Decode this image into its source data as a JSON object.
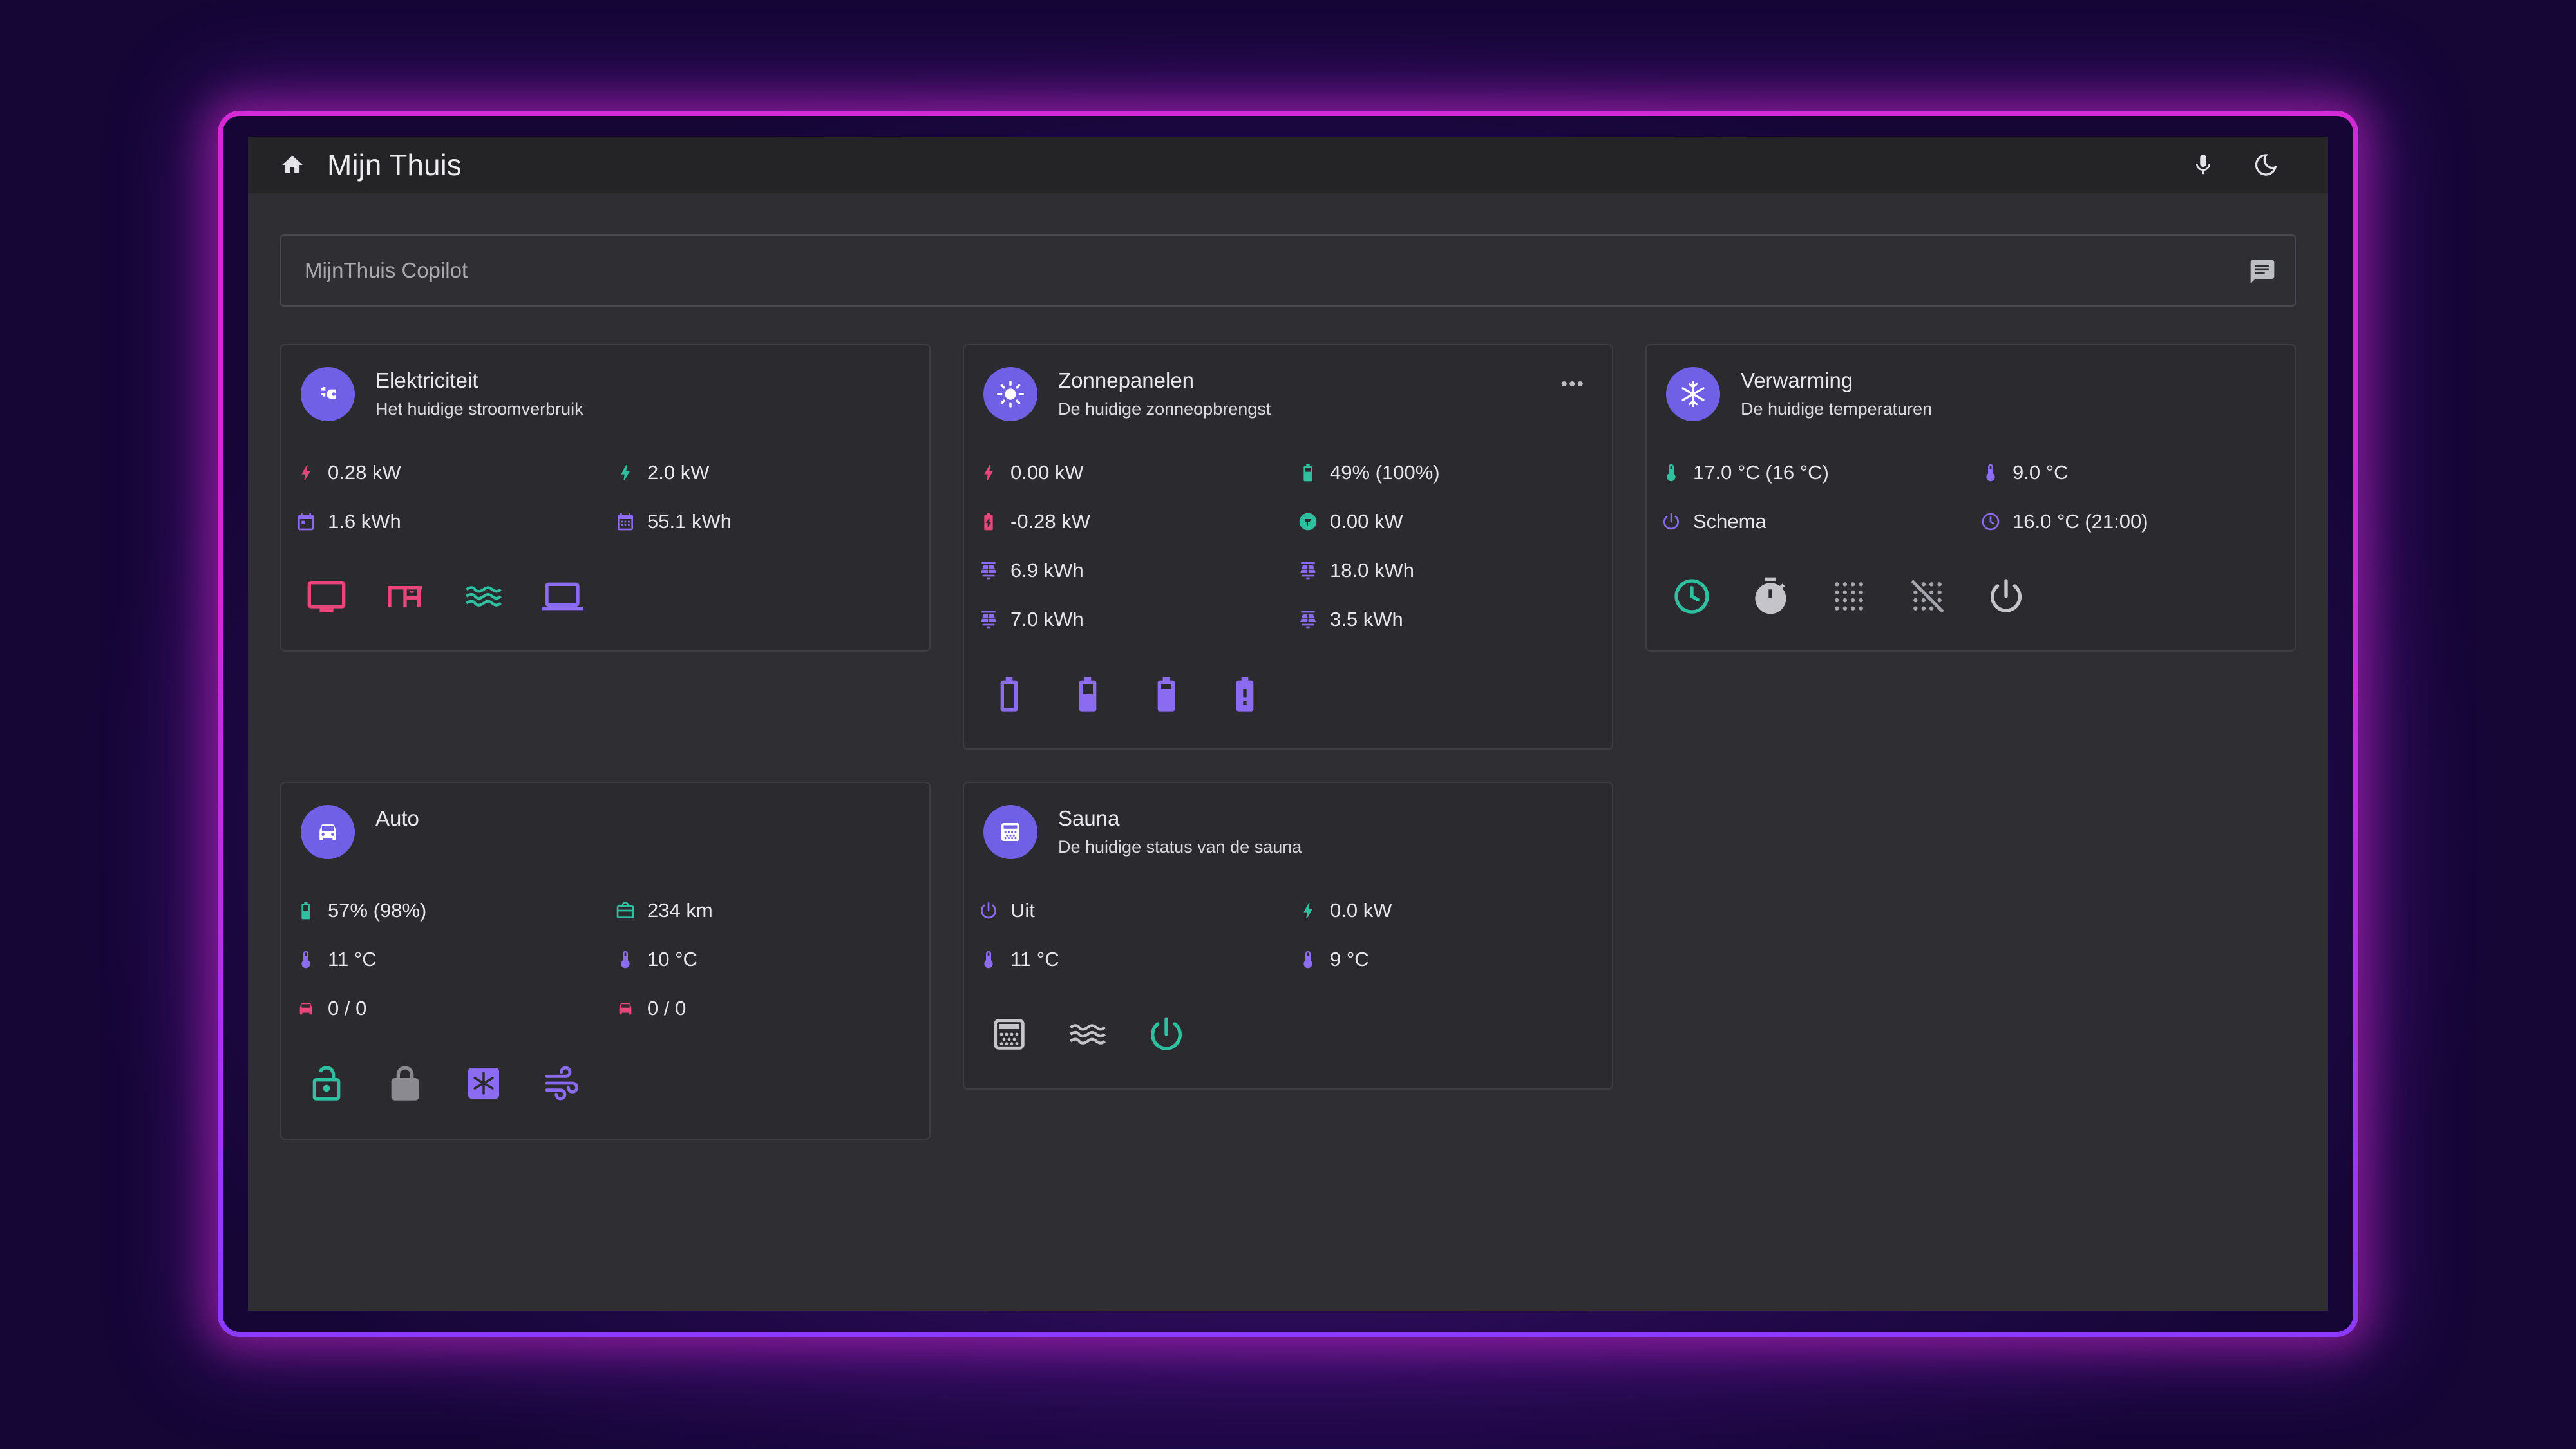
{
  "header": {
    "title": "Mijn Thuis",
    "home_icon": "home-icon",
    "mic_icon": "microphone-icon",
    "theme_icon": "moon-icon"
  },
  "copilot": {
    "placeholder": "MijnThuis Copilot",
    "icon": "chat-icon"
  },
  "colors": {
    "accent": "#6f60e6",
    "pink": "#e8457a",
    "teal": "#2fc0a0",
    "purple": "#8b6cf0",
    "grey": "#8a8a90"
  },
  "elektriciteit": {
    "title": "Elektriciteit",
    "subtitle": "Het huidige stroomverbruik",
    "stats": [
      "0.28 kW",
      "2.0 kW",
      "1.6 kWh",
      "55.1 kWh"
    ],
    "buttons": [
      "tv-icon",
      "desk-icon",
      "heat-wave-icon",
      "laptop-icon"
    ]
  },
  "zonnepanelen": {
    "title": "Zonnepanelen",
    "subtitle": "De huidige zonneopbrengst",
    "more": "•••",
    "stats": [
      "0.00 kW",
      "49% (100%)",
      "-0.28 kW",
      "0.00 kW",
      "6.9 kWh",
      "18.0 kWh",
      "7.0 kWh",
      "3.5 kWh"
    ],
    "buttons": [
      "battery-empty-icon",
      "battery-half-icon",
      "battery-full-icon",
      "battery-alert-icon"
    ]
  },
  "verwarming": {
    "title": "Verwarming",
    "subtitle": "De huidige temperaturen",
    "stats": [
      "17.0 °C (16 °C)",
      "9.0 °C",
      "Schema",
      "16.0 °C (21:00)"
    ],
    "buttons": [
      "clock-icon",
      "timer-icon",
      "grid-dots-icon",
      "grid-off-icon",
      "power-icon"
    ]
  },
  "auto": {
    "title": "Auto",
    "stats": [
      "57% (98%)",
      "234 km",
      "11 °C",
      "10 °C",
      "0 / 0",
      "0 / 0"
    ],
    "buttons": [
      "unlock-icon",
      "lock-icon",
      "climate-icon",
      "fan-icon"
    ]
  },
  "sauna": {
    "title": "Sauna",
    "subtitle": "De huidige status van de sauna",
    "stats": [
      "Uit",
      "0.0 kW",
      "11 °C",
      "9 °C"
    ],
    "buttons": [
      "sauna-icon",
      "heat-icon",
      "power-icon"
    ]
  }
}
